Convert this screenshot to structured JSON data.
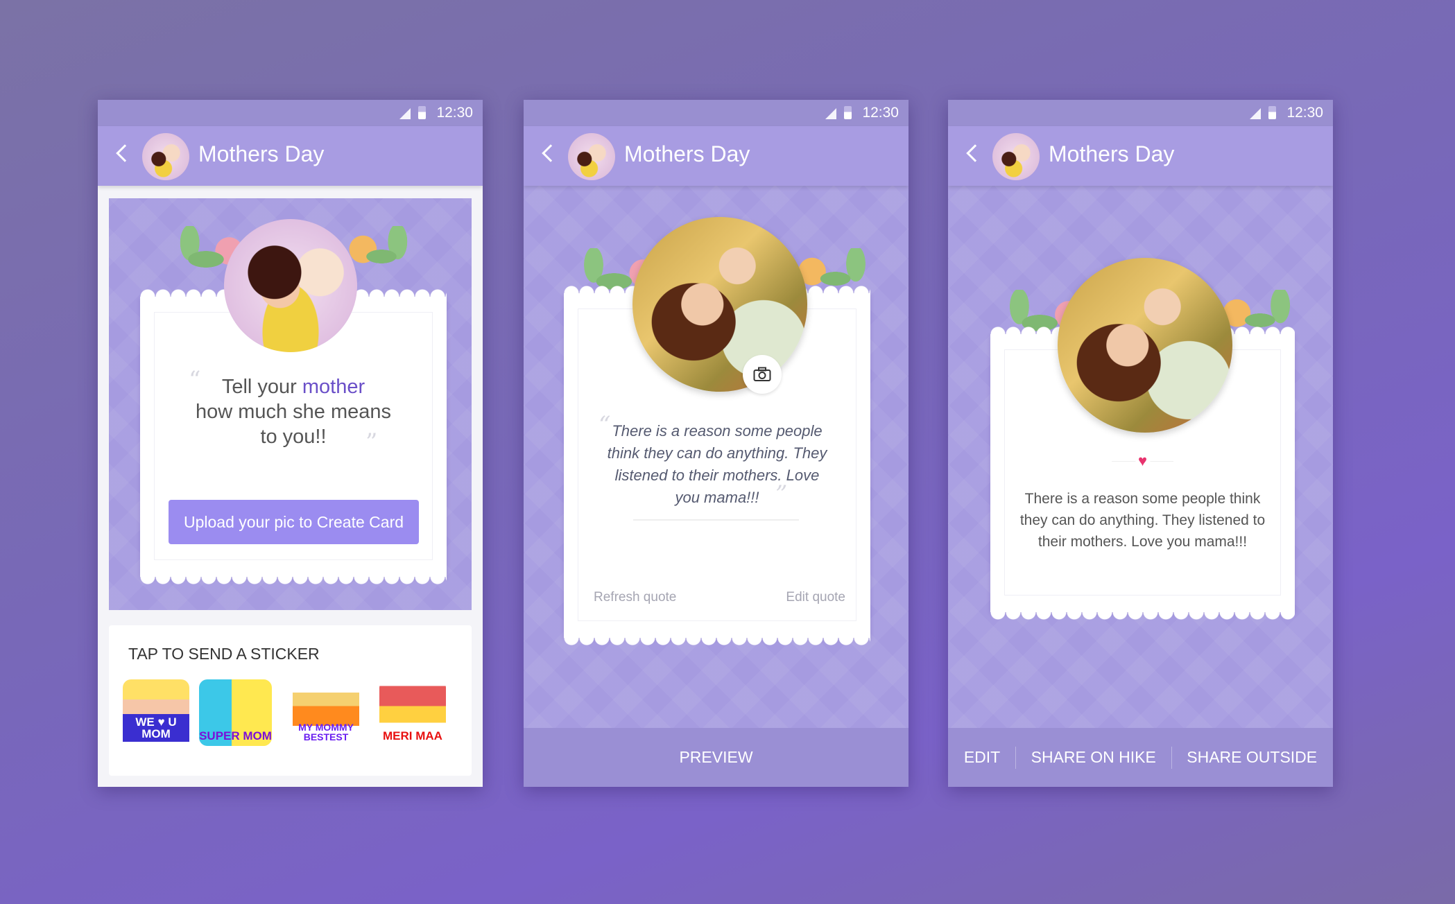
{
  "status": {
    "time": "12:30"
  },
  "app": {
    "title": "Mothers Day"
  },
  "screen1": {
    "prompt_part1": "Tell your ",
    "prompt_highlight": "mother",
    "prompt_part2": "how much she means",
    "prompt_part3": "to you!!",
    "upload_button": "Upload your pic to Create Card",
    "sticker_heading": "TAP TO SEND A STICKER",
    "stickers": [
      {
        "label": "WE ♥ U MOM"
      },
      {
        "label": "SUPER MOM"
      },
      {
        "label": "MY MOMMY BESTEST"
      },
      {
        "label": "MERI MAA"
      }
    ]
  },
  "screen2": {
    "quote_lines": [
      "There is a reason some people",
      "think they can do anything. They",
      "listened to their mothers. Love",
      "you mama!!!"
    ],
    "refresh_quote": "Refresh quote",
    "edit_quote": "Edit quote",
    "preview_button": "PREVIEW"
  },
  "screen3": {
    "quote_lines": [
      "There is a reason some people think",
      "they can do anything. They listened to",
      "their mothers. Love you mama!!!"
    ],
    "edit_button": "EDIT",
    "share_hike_button": "SHARE ON HIKE",
    "share_outside_button": "SHARE OUTSIDE"
  },
  "colors": {
    "accent": "#9b8cf0",
    "header": "#a89ce2",
    "status": "#998fd0",
    "heart": "#e8336e"
  }
}
